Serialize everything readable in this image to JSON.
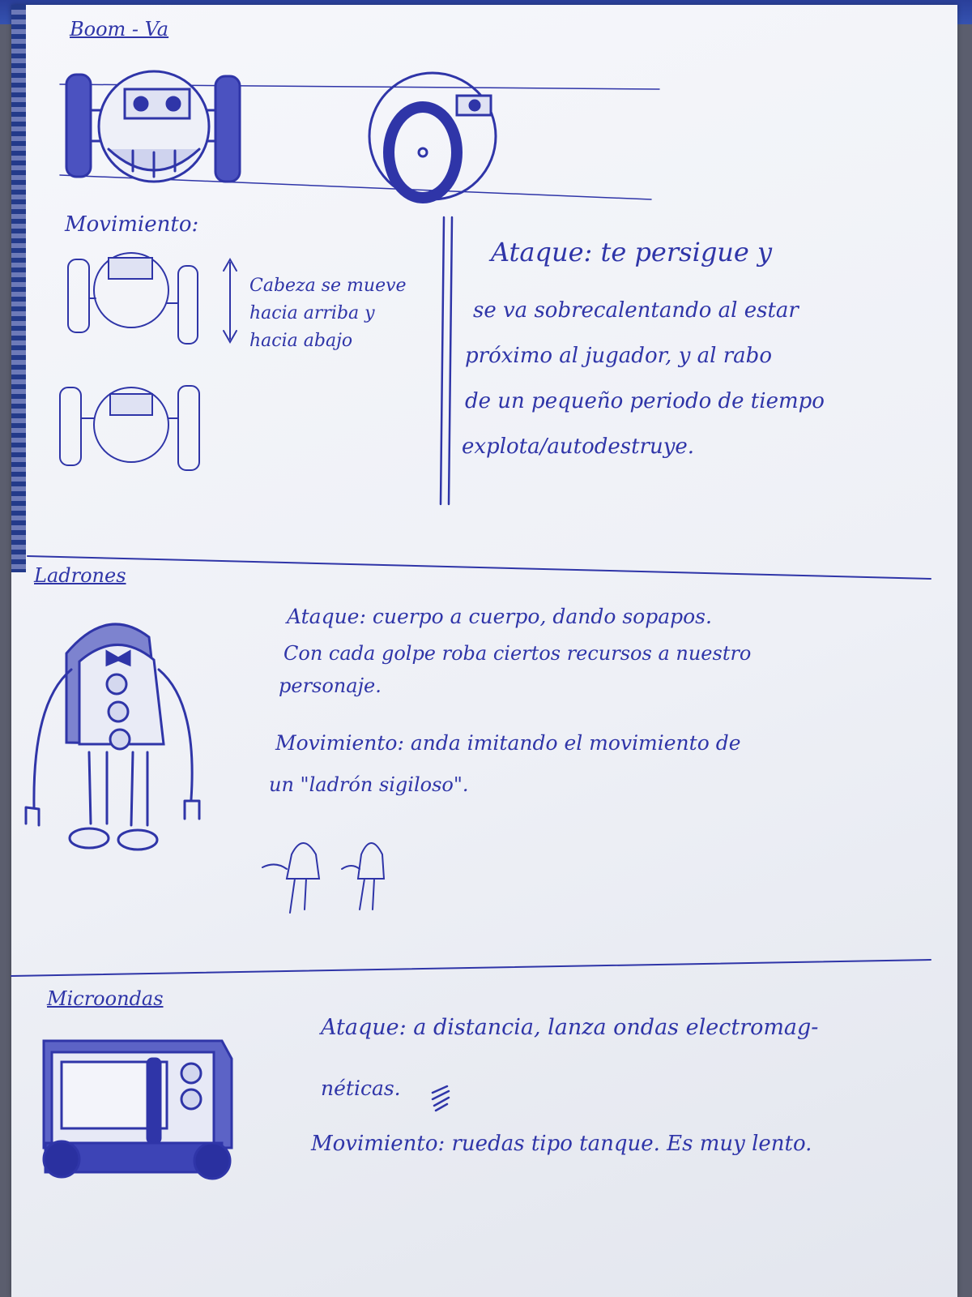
{
  "sections": [
    {
      "title": "Boom - Va",
      "movement_heading": "Movimiento:",
      "movement_note": [
        "Cabeza se mueve",
        "hacia arriba y",
        "hacia abajo"
      ],
      "attack_lines": [
        "Ataque: te persigue y",
        "se va sobrecalentando al estar",
        "próximo al jugador, y al rabo",
        "de un pequeño periodo de tiempo",
        "explota/autodestruye."
      ]
    },
    {
      "title": "Ladrones",
      "text_lines": [
        "Ataque: cuerpo a cuerpo, dando sopapos.",
        "Con cada golpe roba ciertos recursos a nuestro",
        "personaje.",
        "Movimiento: anda imitando el movimiento de",
        "un \"ladrón sigiloso\"."
      ]
    },
    {
      "title": "Microondas",
      "text_lines": [
        "Ataque: a distancia, lanza ondas electromag-",
        "néticas.",
        "Movimiento: ruedas tipo tanque. Es muy lento."
      ]
    }
  ],
  "ink_color": "#2f35a8"
}
